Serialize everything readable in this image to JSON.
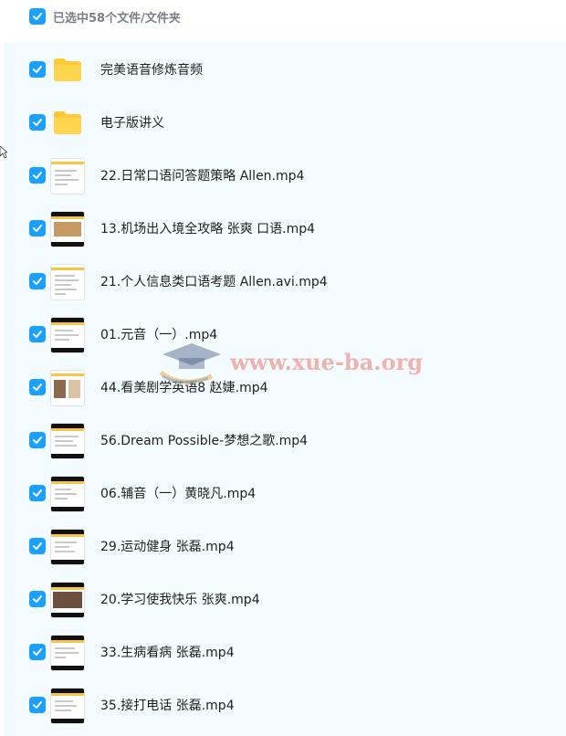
{
  "header": {
    "selection_text": "已选中58个文件/文件夹"
  },
  "files": [
    {
      "name": "完美语音修炼音频",
      "kind": "folder"
    },
    {
      "name": "电子版讲义",
      "kind": "folder"
    },
    {
      "name": "22.日常口语问答题策略 Allen.mp4",
      "kind": "video"
    },
    {
      "name": "13.机场出入境全攻略 张爽 口语.mp4",
      "kind": "video"
    },
    {
      "name": "21.个人信息类口语考题 Allen.avi.mp4",
      "kind": "video"
    },
    {
      "name": "01.元音（一）.mp4",
      "kind": "video"
    },
    {
      "name": "44.看美剧学英语8 赵婕.mp4",
      "kind": "video"
    },
    {
      "name": "56.Dream Possible-梦想之歌.mp4",
      "kind": "video"
    },
    {
      "name": "06.辅音（一）黄晓凡.mp4",
      "kind": "video"
    },
    {
      "name": "29.运动健身 张磊.mp4",
      "kind": "video"
    },
    {
      "name": "20.学习使我快乐 张爽.mp4",
      "kind": "video"
    },
    {
      "name": "33.生病看病 张磊.mp4",
      "kind": "video"
    },
    {
      "name": "35.接打电话 张磊.mp4",
      "kind": "video"
    }
  ],
  "watermark": {
    "text": "www.xue-ba.org"
  },
  "colors": {
    "checkbox": "#1aa1ff",
    "list_background": "#f4fbff",
    "folder": "#ffc935"
  },
  "icons": {
    "checkbox": "checkbox-checked-icon",
    "folder": "folder-icon",
    "video": "video-thumbnail"
  }
}
